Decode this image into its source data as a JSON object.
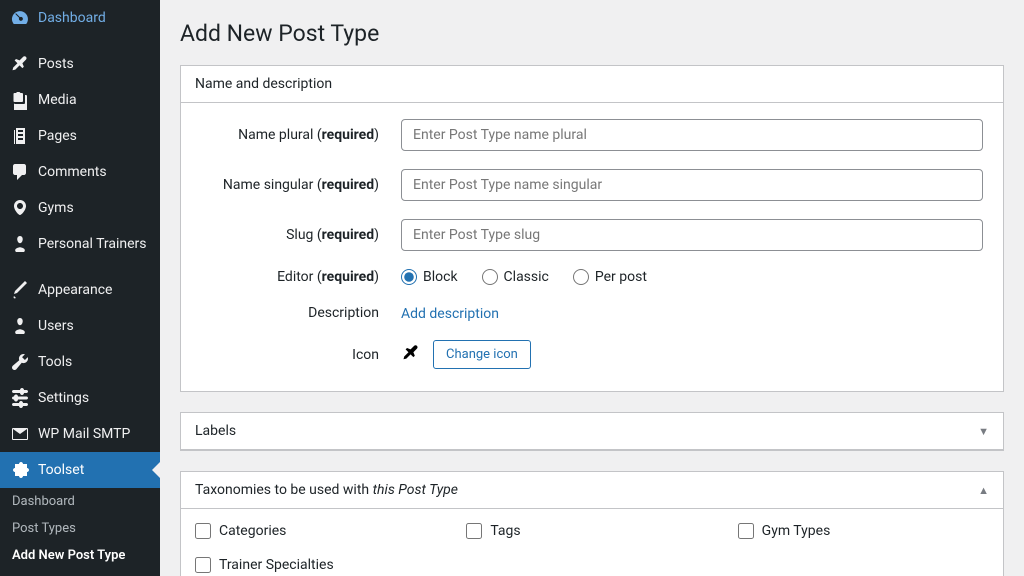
{
  "sidebar": {
    "items": [
      {
        "label": "Dashboard",
        "icon": "gauge"
      },
      {
        "label": "Posts",
        "icon": "pin"
      },
      {
        "label": "Media",
        "icon": "media"
      },
      {
        "label": "Pages",
        "icon": "pages"
      },
      {
        "label": "Comments",
        "icon": "comment"
      },
      {
        "label": "Gyms",
        "icon": "map-marker"
      },
      {
        "label": "Personal Trainers",
        "icon": "user"
      },
      {
        "label": "Appearance",
        "icon": "brush"
      },
      {
        "label": "Users",
        "icon": "user"
      },
      {
        "label": "Tools",
        "icon": "wrench"
      },
      {
        "label": "Settings",
        "icon": "sliders"
      },
      {
        "label": "WP Mail SMTP",
        "icon": "mail"
      },
      {
        "label": "Toolset",
        "icon": "puzzle"
      }
    ],
    "subitems": [
      {
        "label": "Dashboard"
      },
      {
        "label": "Post Types"
      },
      {
        "label": "Add New Post Type"
      }
    ]
  },
  "page": {
    "title": "Add New Post Type"
  },
  "panel1": {
    "title": "Name and description",
    "name_plural_label": "Name plural (",
    "required": "required",
    "close_paren": ")",
    "name_plural_placeholder": "Enter Post Type name plural",
    "name_singular_label": "Name singular (",
    "name_singular_placeholder": "Enter Post Type name singular",
    "slug_label": "Slug (",
    "slug_placeholder": "Enter Post Type slug",
    "editor_label": "Editor (",
    "editor_options": [
      "Block",
      "Classic",
      "Per post"
    ],
    "editor_selected": "Block",
    "description_label": "Description",
    "description_link": "Add description",
    "icon_label": "Icon",
    "icon_button": "Change icon"
  },
  "panel2": {
    "title": "Labels"
  },
  "panel3": {
    "title_pre": "Taxonomies to be used with ",
    "title_em": "this Post Type",
    "options": [
      "Categories",
      "Tags",
      "Gym Types",
      "Trainer Specialties"
    ]
  }
}
